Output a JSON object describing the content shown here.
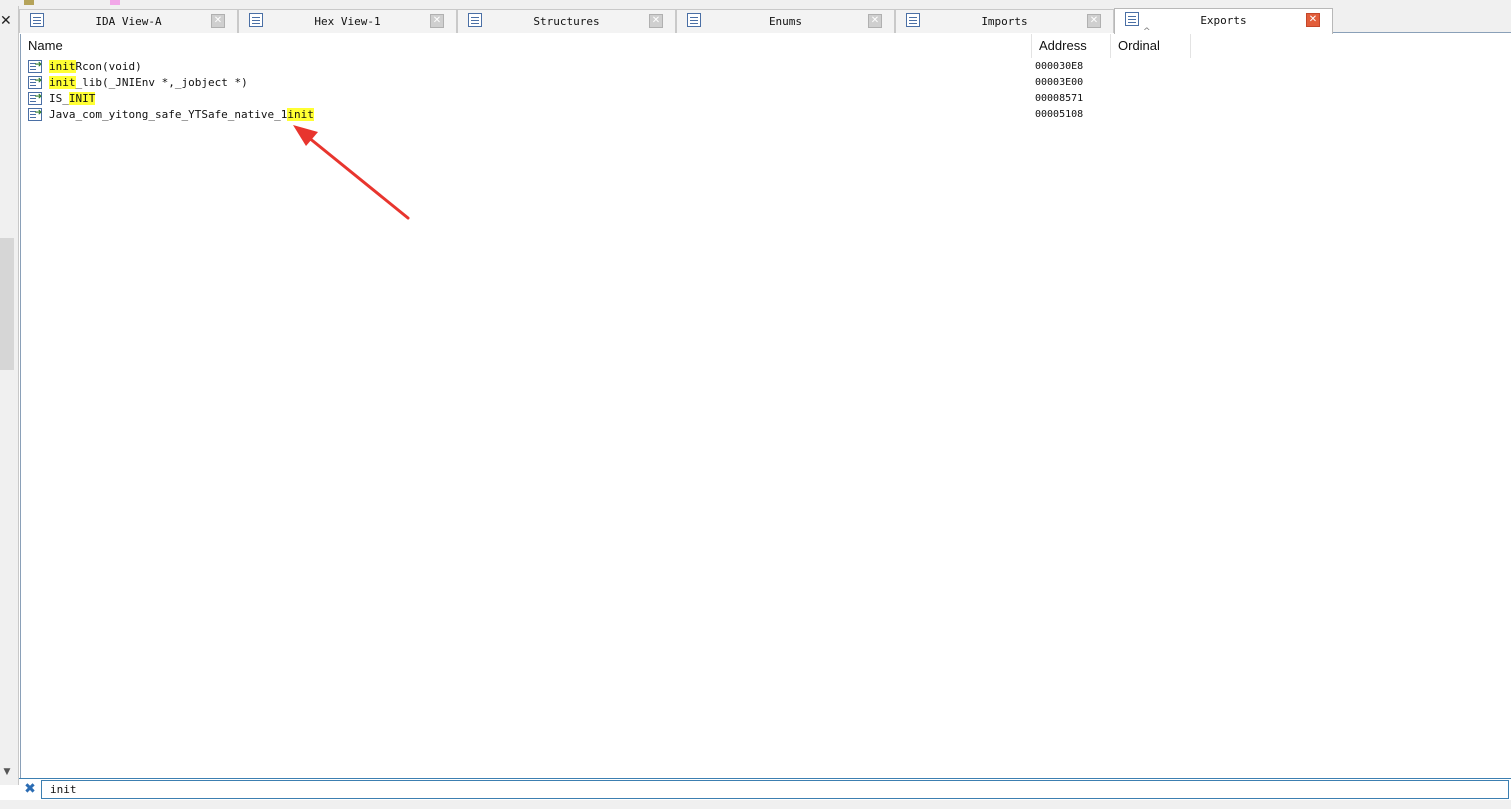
{
  "tabs": [
    {
      "label": "IDA View-A",
      "active": false
    },
    {
      "label": "Hex View-1",
      "active": false
    },
    {
      "label": "Structures",
      "active": false
    },
    {
      "label": "Enums",
      "active": false
    },
    {
      "label": "Imports",
      "active": false
    },
    {
      "label": "Exports",
      "active": true
    }
  ],
  "columns": {
    "name": "Name",
    "address": "Address",
    "ordinal": "Ordinal"
  },
  "rows": [
    {
      "name_before": "",
      "name_match": "init",
      "name_after": "Rcon(void)",
      "address": "000030E8"
    },
    {
      "name_before": "",
      "name_match": "init",
      "name_after": "_lib(_JNIEnv *,_jobject *)",
      "address": "00003E00"
    },
    {
      "name_before": "IS_",
      "name_match": "INIT",
      "name_after": "",
      "address": "00008571"
    },
    {
      "name_before": "Java_com_yitong_safe_YTSafe_native_1",
      "name_match": "init",
      "name_after": "",
      "address": "00005108"
    }
  ],
  "filter": {
    "value": "init"
  },
  "icons": {
    "tab_close": "close-icon",
    "row": "export-function-icon",
    "filter_clear": "clear-filter-icon"
  },
  "colors": {
    "highlight": "#ffff33",
    "active_close": "#e25d3a",
    "annotation_arrow": "#e8352e",
    "accent_border": "#3c7fb1"
  }
}
